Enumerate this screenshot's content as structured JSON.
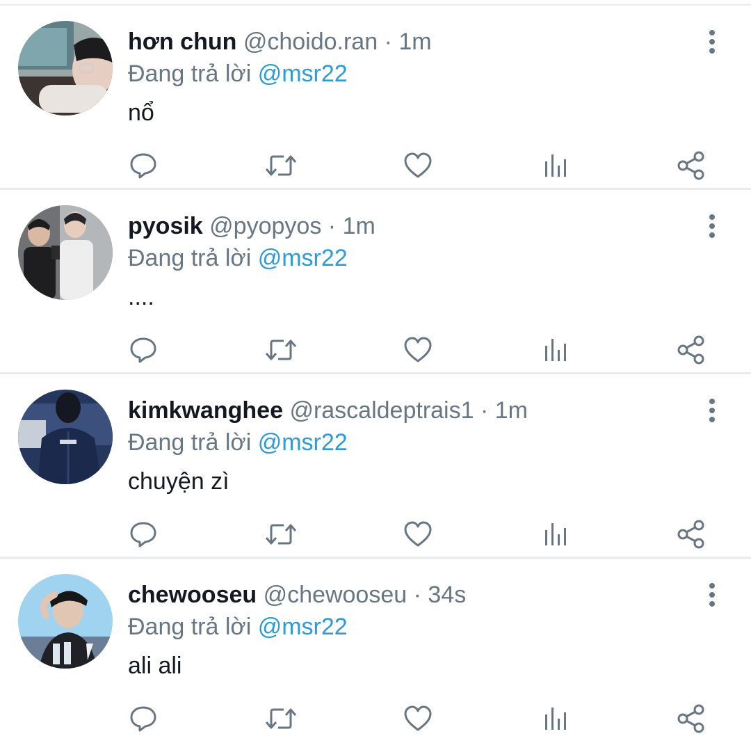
{
  "reply_prefix": "Đang trả lời",
  "colors": {
    "text": "#141823",
    "secondary": "#687684",
    "link": "#2d9bd8",
    "divider": "#e7ebee",
    "icon": "#687684"
  },
  "action_icons": [
    "reply-icon",
    "retweet-icon",
    "like-icon",
    "analytics-icon",
    "share-icon"
  ],
  "tweets": [
    {
      "display_name": "hơn chun",
      "handle": "@choido.ran",
      "separator": "·",
      "time": "1m",
      "replying_to": "@msr22",
      "text": "nổ",
      "avatar": "avatar-photo"
    },
    {
      "display_name": "pyosik",
      "handle": "@pyopyos",
      "separator": "·",
      "time": "1m",
      "replying_to": "@msr22",
      "text": "....",
      "avatar": "avatar-photo"
    },
    {
      "display_name": "kimkwanghee",
      "handle": "@rascaldeptrais1",
      "separator": "·",
      "time": "1m",
      "replying_to": "@msr22",
      "text": "chuyện zì",
      "avatar": "avatar-photo"
    },
    {
      "display_name": "chewooseu",
      "handle": "@chewooseu",
      "separator": "·",
      "time": "34s",
      "replying_to": "@msr22",
      "text": "ali ali",
      "avatar": "avatar-photo"
    }
  ]
}
